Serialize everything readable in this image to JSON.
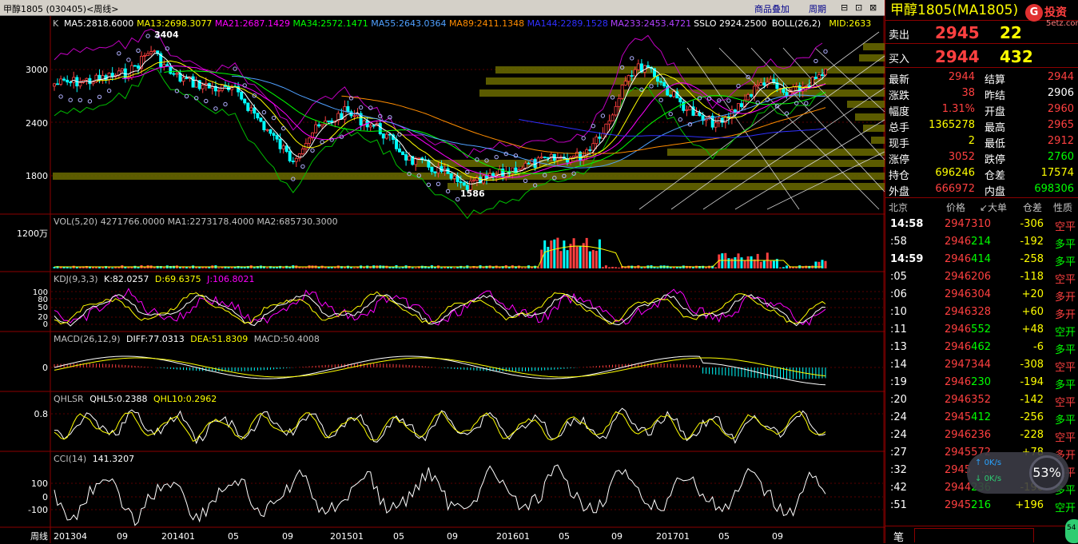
{
  "window": {
    "title": "甲醇1805 (030405)<周线>",
    "btn_overlay": "商品叠加",
    "btn_period": "周期",
    "win_btns": [
      "⊟",
      "⊡",
      "⊠"
    ]
  },
  "main": {
    "k_label": "K",
    "ma_items": [
      {
        "text": "MA5:2818.6000",
        "color": "#ffffff"
      },
      {
        "text": "MA13:2698.3077",
        "color": "#ffff00"
      },
      {
        "text": "MA21:2687.1429",
        "color": "#ff00ff"
      },
      {
        "text": "MA34:2572.1471",
        "color": "#00ff00"
      },
      {
        "text": "MA55:2643.0364",
        "color": "#4fa0ff"
      },
      {
        "text": "MA89:2411.1348",
        "color": "#ff8c00"
      },
      {
        "text": "MA144:2289.1528",
        "color": "#3030ff"
      },
      {
        "text": "MA233:2453.4721",
        "color": "#b040ff"
      },
      {
        "text": "SSLO 2924.2500",
        "color": "#ffffff"
      },
      {
        "text": "BOLL(26,2)",
        "color": "#ffffff"
      },
      {
        "text": "MID:2633",
        "color": "#ffff00"
      }
    ],
    "y_ticks": [
      "3000",
      "2400",
      "1800"
    ],
    "high_marker": "3404",
    "low_marker": "1586"
  },
  "vol": {
    "header": "VOL(5,20) 4271766.0000 MA1:2273178.4000 MA2:685730.3000",
    "y_tick": "1200万"
  },
  "kdj": {
    "label": "KDJ(9,3,3)",
    "k": "K:82.0257",
    "d": "D:69.6375",
    "j": "J:106.8021",
    "y_ticks": [
      "100",
      "80",
      "50",
      "20",
      "0"
    ]
  },
  "macd": {
    "label": "MACD(26,12,9)",
    "diff": "DIFF:77.0313",
    "dea": "DEA:51.8309",
    "macd": "MACD:50.4008",
    "y_tick": "0"
  },
  "qhlsr": {
    "label": "QHLSR",
    "q5": "QHL5:0.2388",
    "q10": "QHL10:0.2962",
    "y_tick": "0.8"
  },
  "cci": {
    "label": "CCI(14)",
    "value": "141.3207",
    "y_ticks": [
      "100",
      "0",
      "-100"
    ]
  },
  "xaxis": {
    "label": "周线",
    "ticks": [
      "201304",
      "09",
      "201401",
      "05",
      "09",
      "201501",
      "05",
      "09",
      "201601",
      "05",
      "09",
      "201701",
      "05",
      "09"
    ]
  },
  "quote": {
    "title": "甲醇1805(MA1805)",
    "logo_text": "投资",
    "logo_url": "5etz.com",
    "sell_label": "卖出",
    "sell_price": "2945",
    "sell_vol": "22",
    "buy_label": "买入",
    "buy_price": "2944",
    "buy_vol": "432",
    "stats": [
      {
        "l1": "最新",
        "v1": "2944",
        "c1": "#ff4040",
        "l2": "结算",
        "v2": "2944",
        "c2": "#ff4040"
      },
      {
        "l1": "涨跌",
        "v1": "38",
        "c1": "#ff4040",
        "l2": "昨结",
        "v2": "2906",
        "c2": "#ffffff"
      },
      {
        "l1": "幅度",
        "v1": "1.31%",
        "c1": "#ff4040",
        "l2": "开盘",
        "v2": "2960",
        "c2": "#ff4040"
      },
      {
        "l1": "总手",
        "v1": "1365278",
        "c1": "#ffff00",
        "l2": "最高",
        "v2": "2965",
        "c2": "#ff4040"
      },
      {
        "l1": "现手",
        "v1": "2",
        "c1": "#ffff00",
        "l2": "最低",
        "v2": "2912",
        "c2": "#ff4040"
      },
      {
        "l1": "涨停",
        "v1": "3052",
        "c1": "#ff4040",
        "l2": "跌停",
        "v2": "2760",
        "c2": "#00ff00"
      },
      {
        "l1": "持仓",
        "v1": "696246",
        "c1": "#ffff00",
        "l2": "仓差",
        "v2": "17574",
        "c2": "#ffff00"
      },
      {
        "l1": "外盘",
        "v1": "666972",
        "c1": "#ff4040",
        "l2": "内盘",
        "v2": "698306",
        "c2": "#00ff00"
      }
    ],
    "tick_header": {
      "place": "北京",
      "price": "价格",
      "vol": "↙大单",
      "oi": "仓差",
      "type": "性质"
    },
    "ticks": [
      {
        "time": "14:58",
        "price": "2947",
        "vol": "310",
        "vc": "#ff4040",
        "oi": "-306",
        "oc": "#ffff00",
        "type": "空平",
        "tc": "#ff4040"
      },
      {
        "time": ":58",
        "price": "2946",
        "vol": "214",
        "vc": "#00ff00",
        "oi": "-192",
        "oc": "#ffff00",
        "type": "多平",
        "tc": "#00ff00"
      },
      {
        "time": "14:59",
        "price": "2946",
        "vol": "414",
        "vc": "#00ff00",
        "oi": "-258",
        "oc": "#ffff00",
        "type": "多平",
        "tc": "#00ff00"
      },
      {
        "time": ":05",
        "price": "2946",
        "vol": "206",
        "vc": "#ff4040",
        "oi": "-118",
        "oc": "#ffff00",
        "type": "空平",
        "tc": "#ff4040"
      },
      {
        "time": ":06",
        "price": "2946",
        "vol": "304",
        "vc": "#ff4040",
        "oi": "+20",
        "oc": "#ffff00",
        "type": "多开",
        "tc": "#ff4040"
      },
      {
        "time": ":10",
        "price": "2946",
        "vol": "328",
        "vc": "#ff4040",
        "oi": "+60",
        "oc": "#ffff00",
        "type": "多开",
        "tc": "#ff4040"
      },
      {
        "time": ":11",
        "price": "2946",
        "vol": "552",
        "vc": "#00ff00",
        "oi": "+48",
        "oc": "#ffff00",
        "type": "空开",
        "tc": "#00ff00"
      },
      {
        "time": ":13",
        "price": "2946",
        "vol": "462",
        "vc": "#00ff00",
        "oi": "-6",
        "oc": "#ffff00",
        "type": "多平",
        "tc": "#00ff00"
      },
      {
        "time": ":14",
        "price": "2947",
        "vol": "344",
        "vc": "#ff4040",
        "oi": "-308",
        "oc": "#ffff00",
        "type": "空平",
        "tc": "#ff4040"
      },
      {
        "time": ":19",
        "price": "2946",
        "vol": "230",
        "vc": "#00ff00",
        "oi": "-194",
        "oc": "#ffff00",
        "type": "多平",
        "tc": "#00ff00"
      },
      {
        "time": ":20",
        "price": "2946",
        "vol": "352",
        "vc": "#ff4040",
        "oi": "-142",
        "oc": "#ffff00",
        "type": "空平",
        "tc": "#ff4040"
      },
      {
        "time": ":24",
        "price": "2945",
        "vol": "412",
        "vc": "#00ff00",
        "oi": "-256",
        "oc": "#ffff00",
        "type": "多平",
        "tc": "#00ff00"
      },
      {
        "time": ":24",
        "price": "2946",
        "vol": "236",
        "vc": "#ff4040",
        "oi": "-228",
        "oc": "#ffff00",
        "type": "空平",
        "tc": "#ff4040"
      },
      {
        "time": ":27",
        "price": "2945",
        "vol": "572",
        "vc": "#ff4040",
        "oi": "+78",
        "oc": "#ffff00",
        "type": "多开",
        "tc": "#ff4040"
      },
      {
        "time": ":32",
        "price": "2945",
        "vol": "...",
        "vc": "#ff4040",
        "oi": "...",
        "oc": "#ffff00",
        "type": "空平",
        "tc": "#ff4040"
      },
      {
        "time": ":42",
        "price": "2944",
        "vol": "236",
        "vc": "#00ff00",
        "oi": "-190",
        "oc": "#ffff00",
        "type": "多平",
        "tc": "#00ff00"
      },
      {
        "time": ":51",
        "price": "2945",
        "vol": "216",
        "vc": "#00ff00",
        "oi": "+196",
        "oc": "#ffff00",
        "type": "空开",
        "tc": "#00ff00"
      }
    ],
    "bottom_label": "笔"
  },
  "net_widget": {
    "up": "0K/s",
    "down": "0K/s",
    "pct": "53%"
  },
  "badge": "54"
}
